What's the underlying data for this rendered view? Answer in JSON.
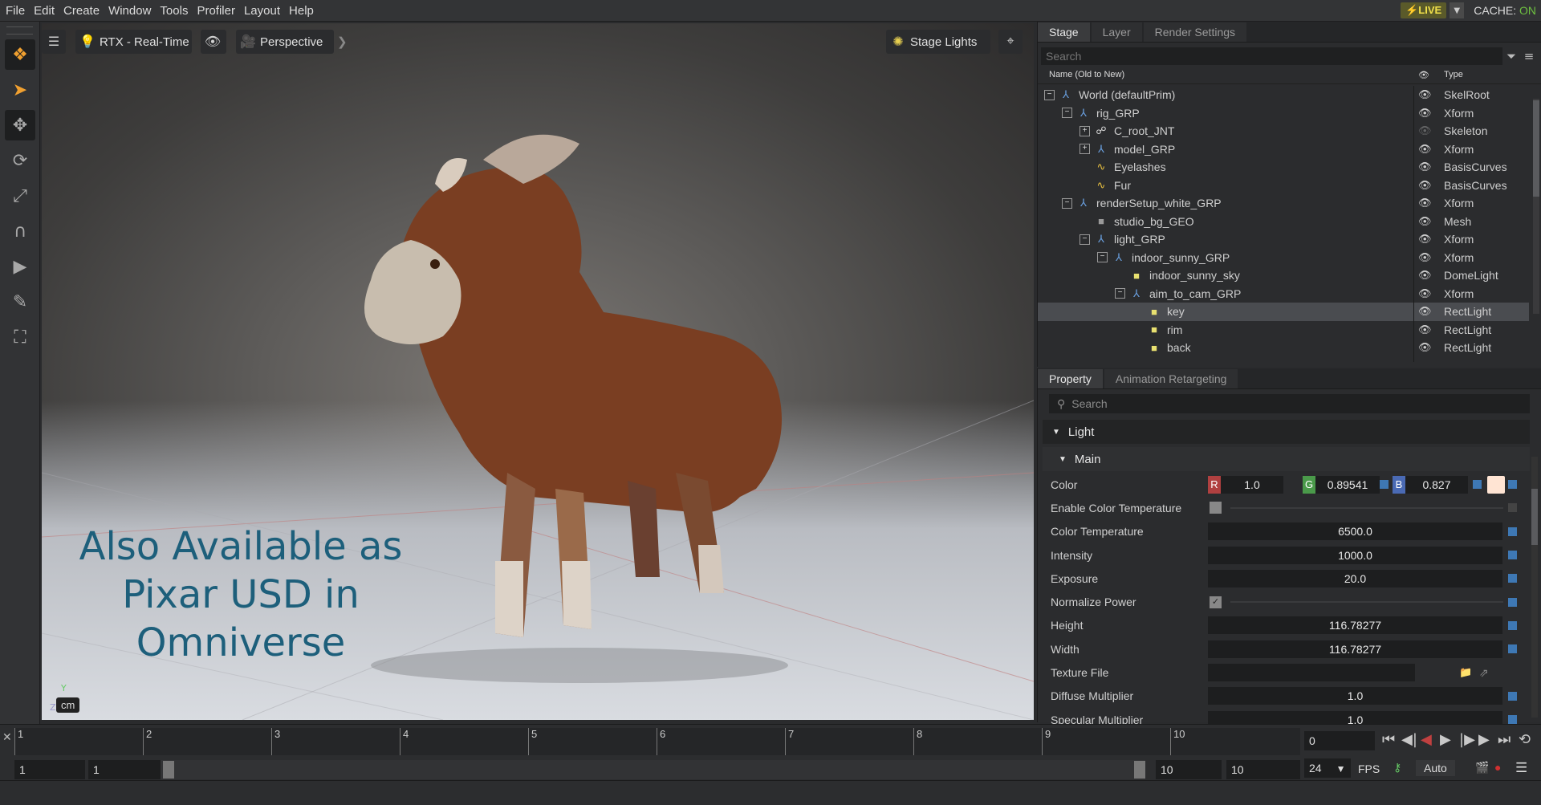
{
  "menubar": {
    "items": [
      "File",
      "Edit",
      "Create",
      "Window",
      "Tools",
      "Profiler",
      "Layout",
      "Help"
    ],
    "live_label": "LIVE",
    "cache_label": "CACHE:",
    "cache_value": "ON"
  },
  "viewport": {
    "renderer": "RTX - Real-Time",
    "camera": "Perspective",
    "lights": "Stage Lights",
    "units": "cm",
    "overlay_lines": [
      "Also Available as",
      "Pixar USD in",
      "Omniverse"
    ],
    "axis": {
      "y": "Y",
      "z": "Z",
      "x": "X"
    }
  },
  "stage": {
    "tabs": [
      "Stage",
      "Layer",
      "Render Settings"
    ],
    "search_placeholder": "Search",
    "col_name": "Name (Old to New)",
    "col_type": "Type",
    "rows": [
      {
        "name": "World (defaultPrim)",
        "type": "SkelRoot",
        "depth": 0,
        "exp": "−",
        "icon": "xform"
      },
      {
        "name": "rig_GRP",
        "type": "Xform",
        "depth": 1,
        "exp": "−",
        "icon": "xform"
      },
      {
        "name": "C_root_JNT",
        "type": "Skeleton",
        "depth": 2,
        "exp": "+",
        "icon": "skel"
      },
      {
        "name": "model_GRP",
        "type": "Xform",
        "depth": 2,
        "exp": "+",
        "icon": "xform"
      },
      {
        "name": "Eyelashes",
        "type": "BasisCurves",
        "depth": 2,
        "exp": "",
        "icon": "curve"
      },
      {
        "name": "Fur",
        "type": "BasisCurves",
        "depth": 2,
        "exp": "",
        "icon": "curve"
      },
      {
        "name": "renderSetup_white_GRP",
        "type": "Xform",
        "depth": 1,
        "exp": "−",
        "icon": "xform"
      },
      {
        "name": "studio_bg_GEO",
        "type": "Mesh",
        "depth": 2,
        "exp": "",
        "icon": "mesh"
      },
      {
        "name": "light_GRP",
        "type": "Xform",
        "depth": 2,
        "exp": "−",
        "icon": "xform"
      },
      {
        "name": "indoor_sunny_GRP",
        "type": "Xform",
        "depth": 3,
        "exp": "−",
        "icon": "xform"
      },
      {
        "name": "indoor_sunny_sky",
        "type": "DomeLight",
        "depth": 4,
        "exp": "",
        "icon": "light"
      },
      {
        "name": "aim_to_cam_GRP",
        "type": "Xform",
        "depth": 4,
        "exp": "−",
        "icon": "xform"
      },
      {
        "name": "key",
        "type": "RectLight",
        "depth": 5,
        "exp": "",
        "icon": "light",
        "selected": true
      },
      {
        "name": "rim",
        "type": "RectLight",
        "depth": 5,
        "exp": "",
        "icon": "light"
      },
      {
        "name": "back",
        "type": "RectLight",
        "depth": 5,
        "exp": "",
        "icon": "light"
      }
    ]
  },
  "property": {
    "tabs": [
      "Property",
      "Animation Retargeting"
    ],
    "search_placeholder": "Search",
    "section": "Light",
    "subsection": "Main",
    "color": {
      "label": "Color",
      "r": "1.0",
      "g": "0.89541",
      "b": "0.827",
      "swatch": "#ffe4d3"
    },
    "rows": [
      {
        "label": "Enable Color Temperature",
        "kind": "check",
        "checked": false
      },
      {
        "label": "Color Temperature",
        "kind": "field",
        "value": "6500.0"
      },
      {
        "label": "Intensity",
        "kind": "field",
        "value": "1000.0"
      },
      {
        "label": "Exposure",
        "kind": "field",
        "value": "20.0"
      },
      {
        "label": "Normalize Power",
        "kind": "check",
        "checked": true
      },
      {
        "label": "Height",
        "kind": "field",
        "value": "116.78277"
      },
      {
        "label": "Width",
        "kind": "field",
        "value": "116.78277"
      },
      {
        "label": "Texture File",
        "kind": "file",
        "value": ""
      },
      {
        "label": "Diffuse Multiplier",
        "kind": "field",
        "value": "1.0"
      },
      {
        "label": "Specular Multiplier",
        "kind": "field",
        "value": "1.0"
      }
    ]
  },
  "timeline": {
    "ticks": [
      "1",
      "2",
      "3",
      "4",
      "5",
      "6",
      "7",
      "8",
      "9",
      "10"
    ],
    "current_frame": "0",
    "start": "1",
    "range_start": "1",
    "range_end": "10",
    "end": "10",
    "fps_value": "24",
    "fps_label": "FPS",
    "auto_label": "Auto"
  }
}
